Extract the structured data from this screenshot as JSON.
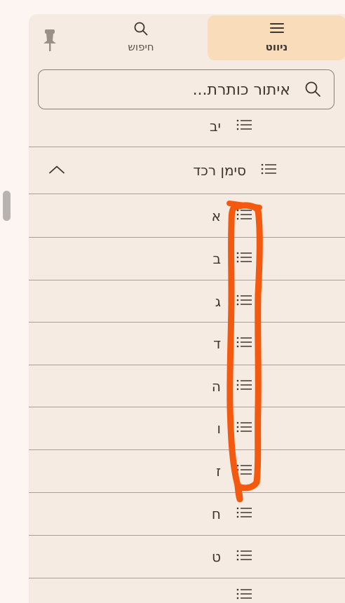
{
  "tabs": {
    "navigation_label": "ניווט",
    "search_label": "חיפוש"
  },
  "search": {
    "placeholder": "איתור כותרת..."
  },
  "list": {
    "top_item": "יב",
    "section": "סימן רכד",
    "items": [
      "א",
      "ב",
      "ג",
      "ד",
      "ה",
      "ו",
      "ז",
      "ח",
      "ט"
    ]
  },
  "colors": {
    "panel_bg": "#f5ebe2",
    "active_tab": "#f9dcba",
    "annotation_stroke": "#f45a0f"
  }
}
